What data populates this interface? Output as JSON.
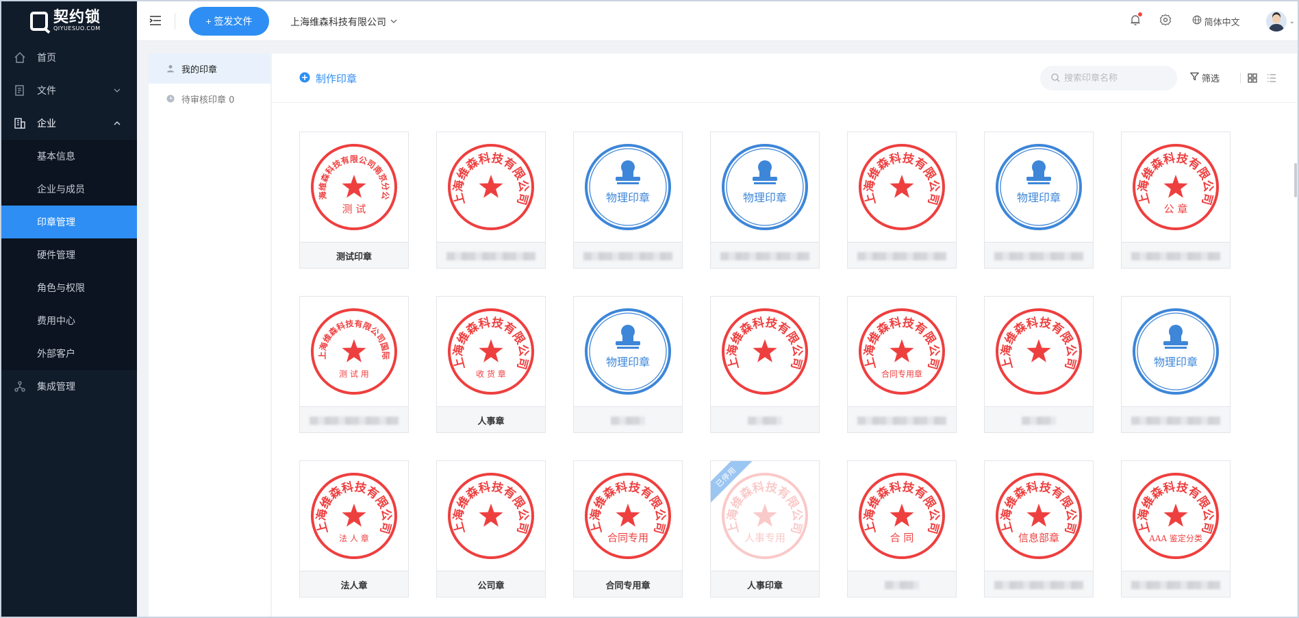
{
  "brand": {
    "name_cn": "契约锁",
    "name_en": "QIYUESUO.COM"
  },
  "sidebar": {
    "items": [
      {
        "label": "首页"
      },
      {
        "label": "文件"
      },
      {
        "label": "企业"
      }
    ],
    "sub_items": [
      {
        "label": "基本信息"
      },
      {
        "label": "企业与成员"
      },
      {
        "label": "印章管理"
      },
      {
        "label": "硬件管理"
      },
      {
        "label": "角色与权限"
      },
      {
        "label": "费用中心"
      },
      {
        "label": "外部客户"
      }
    ],
    "bottom_item": {
      "label": "集成管理"
    }
  },
  "header": {
    "send_button": "+ 签发文件",
    "company": "上海维森科技有限公司",
    "language": "简体中文"
  },
  "subpanel": {
    "my_seals": "我的印章",
    "pending": "待审核印章 0"
  },
  "toolbar": {
    "make_seal": "制作印章",
    "search_placeholder": "搜索印章名称",
    "filter": "筛选"
  },
  "colors": {
    "red_seal": "#ee3f3f",
    "blue_seal": "#3d86d8",
    "accent": "#2e8ef3",
    "sidebar_bg": "#111c2b"
  },
  "seals": [
    {
      "kind": "red",
      "ring_text": "上海维森科技有限公司南京分公司",
      "center_text": "测 试",
      "label": "测试印章"
    },
    {
      "kind": "red",
      "ring_text": "上海维森科技有限公司",
      "center_text": "",
      "label": ""
    },
    {
      "kind": "blue",
      "center_text": "物理印章",
      "label": ""
    },
    {
      "kind": "blue",
      "center_text": "物理印章",
      "label": ""
    },
    {
      "kind": "red",
      "ring_text": "上海维森科技有限公司",
      "center_text": "",
      "label": ""
    },
    {
      "kind": "blue",
      "center_text": "物理印章",
      "label": ""
    },
    {
      "kind": "red",
      "ring_text": "上海维森科技有限公司",
      "center_text": "公 章",
      "label": ""
    },
    {
      "kind": "red",
      "ring_text": "上海维森科技有限公司国际",
      "center_text": "测 试 用",
      "label": ""
    },
    {
      "kind": "red",
      "ring_text": "上海维森科技有限公司",
      "center_text": "收 货 章",
      "label": "人事章"
    },
    {
      "kind": "blue",
      "center_text": "物理印章",
      "label": ""
    },
    {
      "kind": "red",
      "ring_text": "上海维森科技有限公司",
      "center_text": "",
      "label": ""
    },
    {
      "kind": "red",
      "ring_text": "上海维森科技有限公司",
      "center_text": "合同专用章",
      "label": ""
    },
    {
      "kind": "red",
      "ring_text": "上海维森科技有限公司",
      "center_text": "",
      "label": ""
    },
    {
      "kind": "blue",
      "center_text": "物理印章",
      "label": ""
    },
    {
      "kind": "red",
      "ring_text": "上海维森科技有限公司",
      "center_text": "法 人 章",
      "label": "法人章"
    },
    {
      "kind": "red",
      "ring_text": "上海维森科技有限公司",
      "center_text": "",
      "label": "公司章"
    },
    {
      "kind": "red",
      "ring_text": "上海维森科技有限公司",
      "center_text": "合同专用",
      "label": "合同专用章"
    },
    {
      "kind": "red",
      "ring_text": "上海维森科技有限公司",
      "center_text": "人事专用",
      "label": "人事印章",
      "ribbon": "已停用"
    },
    {
      "kind": "red",
      "ring_text": "上海维森科技有限公司",
      "center_text": "合 同",
      "label": ""
    },
    {
      "kind": "red",
      "ring_text": "上海维森科技有限公司",
      "center_text": "信息部章",
      "label": ""
    },
    {
      "kind": "red",
      "ring_text": "上海维森科技有限公司",
      "center_text": "AAA 鉴定分类",
      "label": ""
    }
  ]
}
